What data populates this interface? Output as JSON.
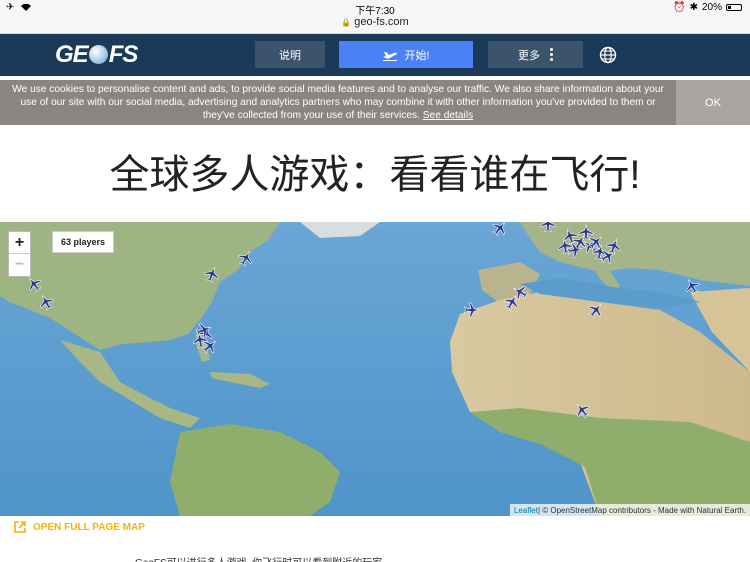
{
  "status_bar": {
    "time": "下午7:30",
    "battery": "20%"
  },
  "url_bar": {
    "url": "geo-fs.com"
  },
  "header": {
    "logo": {
      "part1": "GE",
      "part2": "FS"
    },
    "help_label": "说明",
    "start_label": "开始!",
    "more_label": "更多"
  },
  "cookie": {
    "text": "We use cookies to personalise content and ads, to provide social media features and to analyse our traffic. We also share information about your use of our site with our social media, advertising and analytics partners who may combine it with other information you've provided to them or they've collected from your use of their services.",
    "link_label": "See details",
    "ok_label": "OK"
  },
  "title": "全球多人游戏：看看谁在飞行!",
  "map": {
    "zoom_in_label": "+",
    "zoom_out_label": "−",
    "players_label": "63 players",
    "attribution_link": "Leaflet",
    "attribution_text": " | © OpenStreetMap contributors - Made with Natural Earth.",
    "ocean_color": "#5b9ecf",
    "land_color": "#a9b98c",
    "plane_color": "#2a3a8c"
  },
  "open_map_label": "OPEN FULL PAGE MAP",
  "body_text": "GeoFS可以进行多人游戏, 你飞行时可以看到附近的玩家"
}
